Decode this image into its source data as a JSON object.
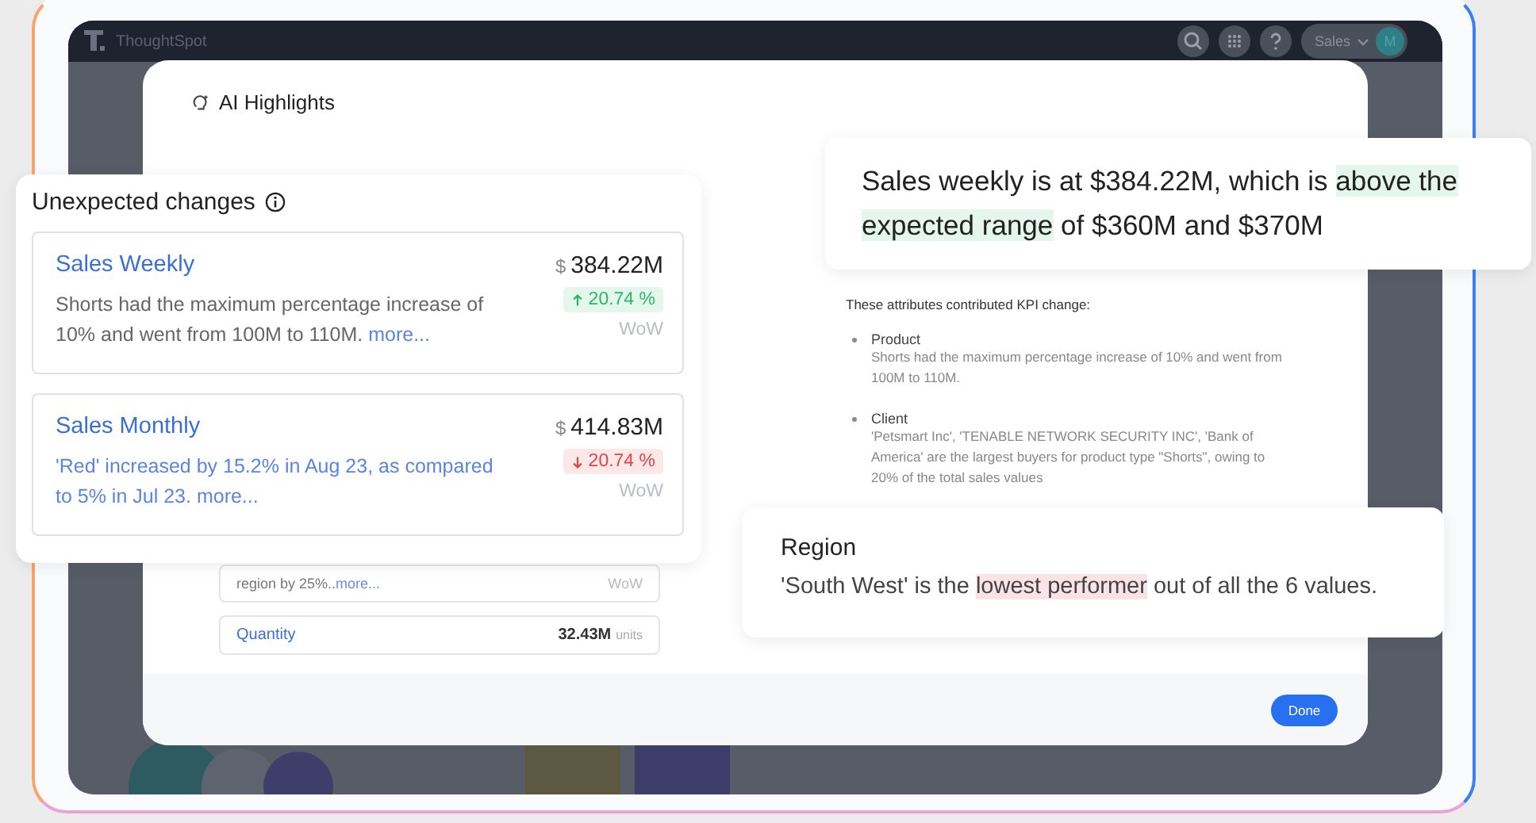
{
  "app": {
    "brand": "ThoughtSpot",
    "account_menu": "Sales",
    "avatar": "M"
  },
  "modal": {
    "title": "AI Highlights",
    "attributes_heading": "These attributes contributed KPI change:",
    "attributes": [
      {
        "name": "Product",
        "text": "Shorts had the maximum percentage increase of 10% and went from 100M to 110M."
      },
      {
        "name": "Client",
        "text": "'Petsmart Inc', 'TENABLE NETWORK SECURITY INC', 'Bank of America' are the largest buyers for product type \"Shorts\", owing to 20% of the total sales values"
      }
    ],
    "background_cards": [
      {
        "kind": "text",
        "text": "region by 25%..",
        "link": "more...",
        "period": "WoW"
      },
      {
        "kind": "metric",
        "title": "Quantity",
        "value": "32.43M",
        "unit": "units"
      }
    ],
    "done_button": "Done"
  },
  "unexpected_changes": {
    "title": "Unexpected changes",
    "cards": [
      {
        "title": "Sales Weekly",
        "currency": "$",
        "value": "384.22M",
        "text": "Shorts had the maximum percentage increase of 10% and went from 100M to 110M.",
        "link": "more...",
        "increase": true,
        "change": "20.74 %",
        "period": "WoW",
        "highlighted": false
      },
      {
        "title": "Sales Monthly",
        "currency": "$",
        "value": "414.83M",
        "text": "'Red' increased by 15.2% in Aug 23, as compared to 5% in  Jul 23.",
        "link": "more...",
        "increase": false,
        "change": "20.74 %",
        "period": "WoW",
        "highlighted": true
      }
    ]
  },
  "callouts": [
    {
      "kind": "summary",
      "parts": [
        {
          "text": "Sales weekly is at $384.22M, which is ",
          "highlight": false
        },
        {
          "text": "above the expected range",
          "highlight": true
        },
        {
          "text": " of $360M and $370M",
          "highlight": false
        }
      ]
    },
    {
      "kind": "region",
      "title": "Region",
      "parts": [
        {
          "text": "'South West' is the ",
          "highlight": false
        },
        {
          "text": "lowest performer",
          "highlight": true
        },
        {
          "text": " out of all the 6 values.",
          "highlight": false
        }
      ]
    }
  ]
}
